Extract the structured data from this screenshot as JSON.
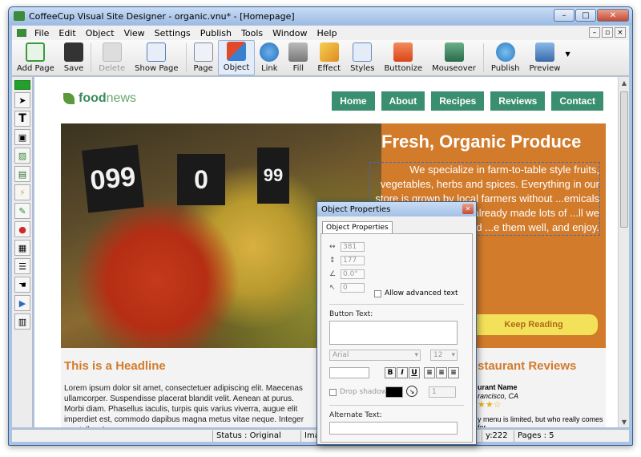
{
  "window": {
    "title": "CoffeeCup Visual Site Designer - organic.vnu* - [Homepage]",
    "minimize": "–",
    "maximize": "□",
    "close": "✕"
  },
  "menu": [
    "File",
    "Edit",
    "Object",
    "View",
    "Settings",
    "Publish",
    "Tools",
    "Window",
    "Help"
  ],
  "toolbar": [
    {
      "label": "Add Page",
      "icon": "add-page-icon",
      "color": "#3a9a3a"
    },
    {
      "label": "Save",
      "icon": "save-icon",
      "color": "#333333"
    },
    {
      "label": "Delete",
      "icon": "delete-icon",
      "color": "#bbbbbb"
    },
    {
      "label": "Show Page",
      "icon": "show-page-icon",
      "color": "#5580c0"
    },
    {
      "label": "Page",
      "icon": "page-icon",
      "color": "#d8e4f4"
    },
    {
      "label": "Object",
      "icon": "object-icon",
      "color": "#e04a2a"
    },
    {
      "label": "Link",
      "icon": "link-icon",
      "color": "#2a70c0"
    },
    {
      "label": "Fill",
      "icon": "fill-icon",
      "color": "#888888"
    },
    {
      "label": "Effect",
      "icon": "effect-icon",
      "color": "#e8b020"
    },
    {
      "label": "Styles",
      "icon": "styles-icon",
      "color": "#6a8ac0"
    },
    {
      "label": "Buttonize",
      "icon": "buttonize-icon",
      "color": "#e85a2a"
    },
    {
      "label": "Mouseover",
      "icon": "mouseover-icon",
      "color": "#3a8a5a"
    },
    {
      "label": "Publish",
      "icon": "publish-icon",
      "color": "#2a8ad0"
    },
    {
      "label": "Preview",
      "icon": "preview-icon",
      "color": "#4a7ac0"
    }
  ],
  "site": {
    "logo_food": "food",
    "logo_news": "news",
    "nav": [
      "Home",
      "About",
      "Recipes",
      "Reviews",
      "Contact"
    ],
    "hero_title": "Fresh, Organic Produce",
    "hero_copy": "We specialize in farm-to-table style fruits, vegetables, herbs and spices. Everything in our store is grown by local farmers without ...emicals or pesticides. ...re already made lots of ...ll we have to do is find ...e them well, and enjoy.",
    "signs": [
      "099",
      "0",
      "99"
    ],
    "keep_reading": "Keep Reading",
    "headline": "This is a Headline",
    "body": "Lorem ipsum dolor sit amet, consectetuer adipiscing elit. Maecenas ullamcorper. Suspendisse placerat blandit velit. Aenean at purus. Morbi diam. Phasellus iaculis, turpis quis varius viverra, augue elit imperdiet est, commodo dapibus magna metus vitae neque. Integer nec tellus. In",
    "reviews_title": "staurant Reviews",
    "review_name": "urant Name",
    "review_loc": "rancisco, CA",
    "review_stars": "★★☆",
    "review_text": "y menu is limited, but who really comes for"
  },
  "status": {
    "status": "Status : Original",
    "img": "Imag",
    "y": "y:222",
    "pages": "Pages : 5"
  },
  "dialog": {
    "title": "Object Properties",
    "tab": "Object Properties",
    "width": "381",
    "height": "177",
    "angle": "0.0°",
    "skew": "0",
    "advanced": "Allow advanced text",
    "button_text_label": "Button Text:",
    "font": "Arial",
    "size": "12",
    "bold": "B",
    "italic": "I",
    "underline": "U",
    "drop_shadow": "Drop shadow",
    "shadow_num": "1",
    "alt_label": "Alternate Text:"
  }
}
